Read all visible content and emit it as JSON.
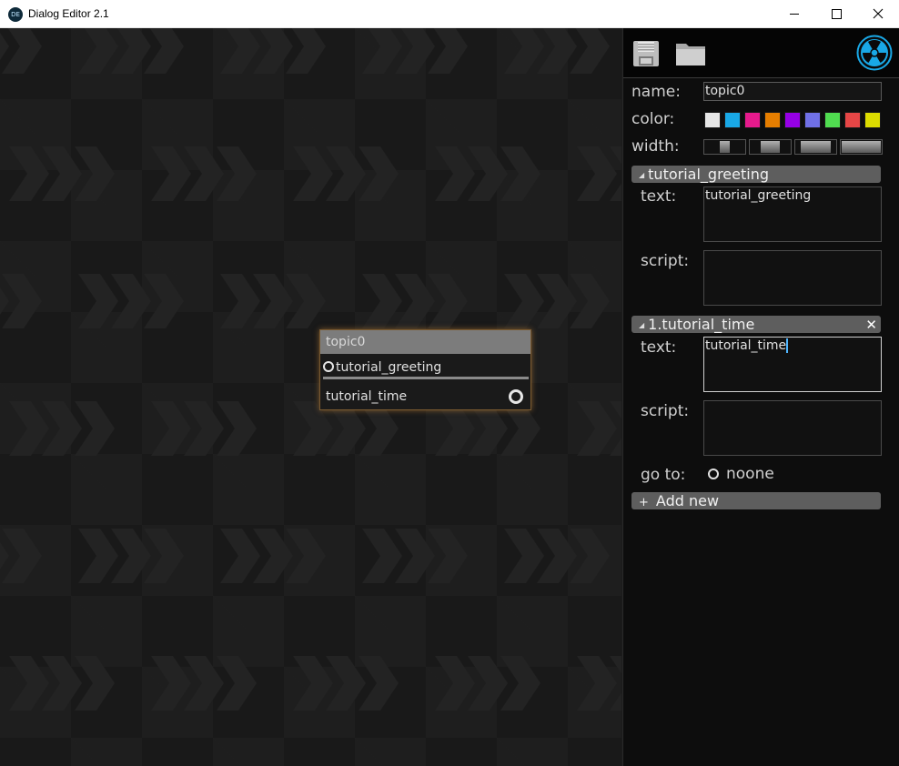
{
  "window": {
    "title": "Dialog Editor 2.1",
    "icon_text": "DE"
  },
  "node": {
    "title": "topic0",
    "input_label": "tutorial_greeting",
    "output_label": "tutorial_time"
  },
  "panel": {
    "name_label": "name:",
    "name_value": "topic0",
    "color_label": "color:",
    "colors": [
      "#e6e6e6",
      "#19a8e6",
      "#e61a8c",
      "#e67e00",
      "#9600e6",
      "#7070e6",
      "#50dc50",
      "#e64646",
      "#dcdc00"
    ],
    "width_label": "width:",
    "width_options": [
      "1",
      "2",
      "3",
      "4"
    ],
    "section1": {
      "title": "tutorial_greeting",
      "text_label": "text:",
      "text_value": "tutorial_greeting",
      "script_label": "script:",
      "script_value": ""
    },
    "section2": {
      "title": "1.tutorial_time",
      "close": "✕",
      "text_label": "text:",
      "text_value": "tutorial_time",
      "script_label": "script:",
      "script_value": "",
      "goto_label": "go to:",
      "goto_value": "noone"
    },
    "add_new": "Add new",
    "add_icon": "+"
  },
  "icons": {
    "save": "save-icon",
    "open": "folder-icon",
    "logo": "radiation-icon"
  },
  "accent": "#19a8e6"
}
